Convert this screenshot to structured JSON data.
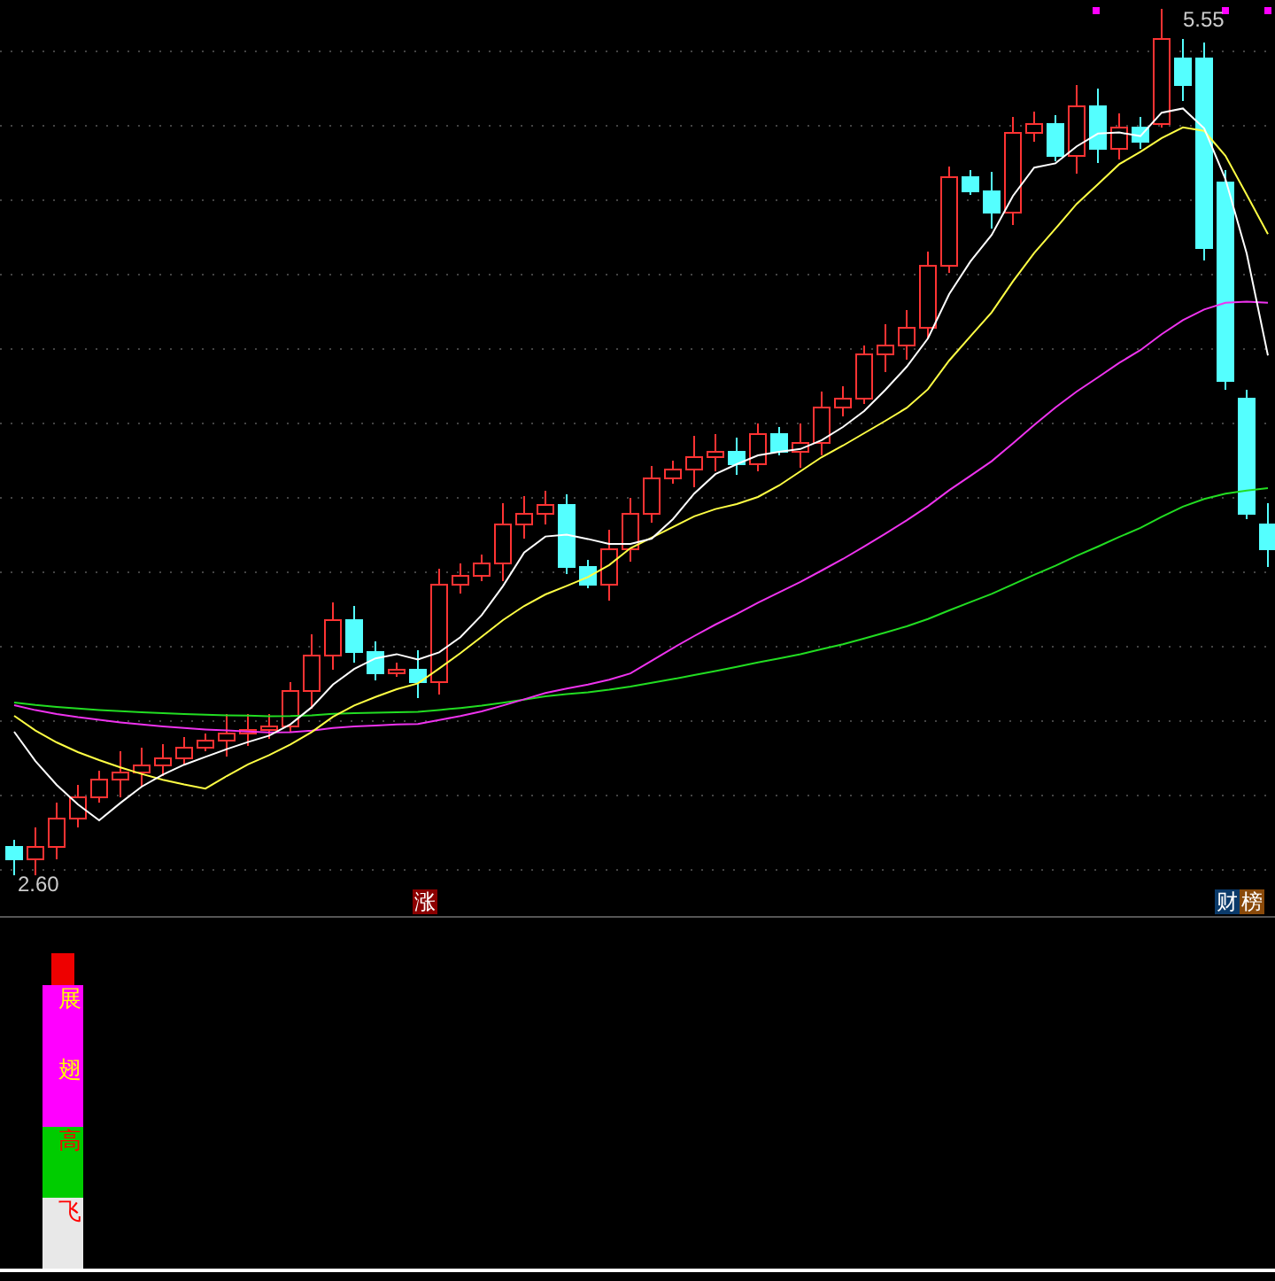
{
  "chart": {
    "high_label": "5.55",
    "low_label": "2.60"
  },
  "markers": [
    {
      "text": "涨",
      "color": "#8b0000"
    },
    {
      "text": "财",
      "color": "#0a3a6a"
    },
    {
      "text": "榜",
      "color": "#8a4a0a"
    }
  ],
  "indicator": {
    "segments": [
      {
        "text": "展",
        "color": "#ff00ff",
        "kind": "upper"
      },
      {
        "text": "翅",
        "color": "#ff00ff",
        "kind": "upper"
      },
      {
        "text": "高",
        "color": "#00cc00",
        "kind": "lower"
      },
      {
        "text": "飞",
        "color": "#e8e8e8",
        "kind": "lower"
      }
    ]
  }
}
